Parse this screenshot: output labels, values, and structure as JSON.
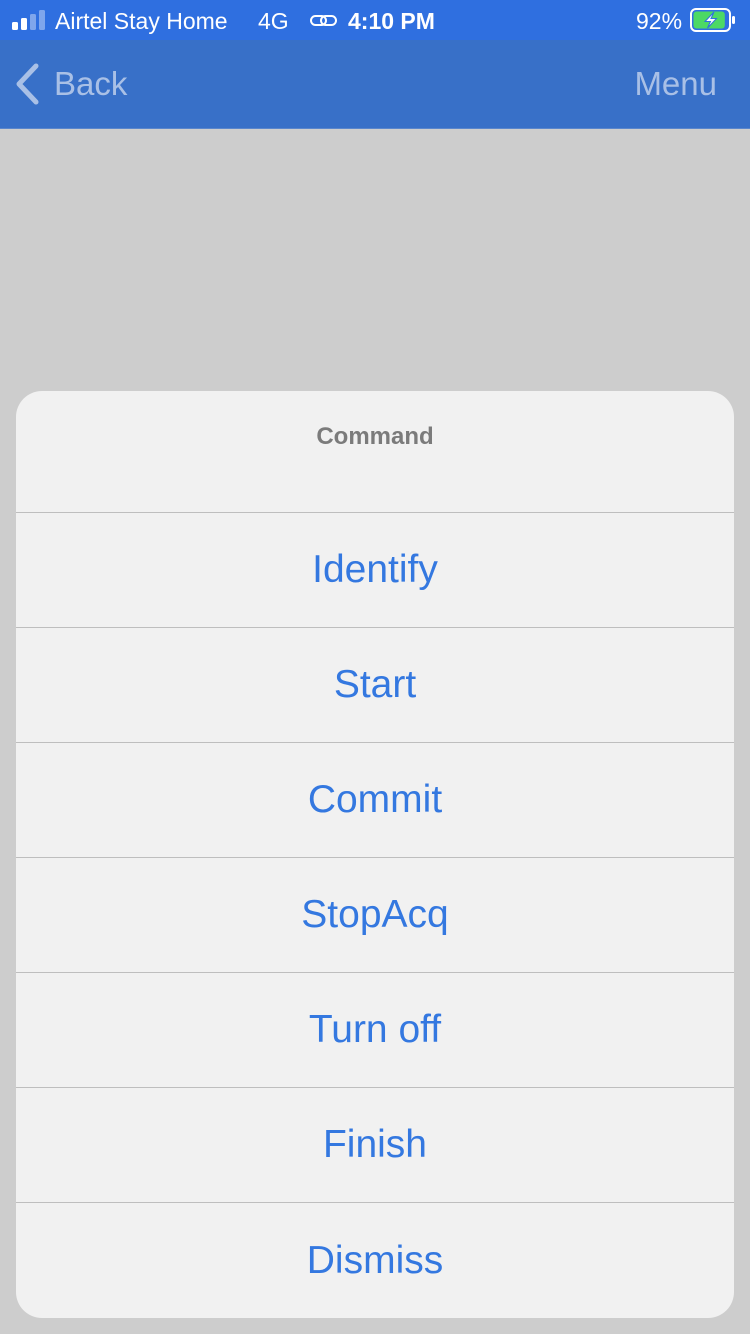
{
  "status_bar": {
    "carrier": "Airtel Stay Home",
    "network": "4G",
    "time": "4:10 PM",
    "battery": "92%",
    "signal_icon": "signal-bars-icon",
    "link_icon": "link-icon",
    "battery_icon": "battery-charging-icon",
    "battery_level": 0.92
  },
  "nav": {
    "back_label": "Back",
    "menu_label": "Menu",
    "back_icon": "chevron-left-icon"
  },
  "action_sheet": {
    "title": "Command",
    "actions": [
      {
        "label": "Identify"
      },
      {
        "label": "Start"
      },
      {
        "label": "Commit"
      },
      {
        "label": "StopAcq"
      },
      {
        "label": "Turn off"
      },
      {
        "label": "Finish"
      },
      {
        "label": "Dismiss"
      }
    ]
  },
  "colors": {
    "status_bar_bg": "#2f6fe0",
    "nav_bar_bg": "#3870c8",
    "nav_text": "#a9c0e6",
    "action_text": "#3478e0",
    "title_text": "#7b7b7b",
    "sheet_bg": "#f1f1f1",
    "backdrop": "#cdcdcd",
    "battery_fill": "#4cd964"
  }
}
